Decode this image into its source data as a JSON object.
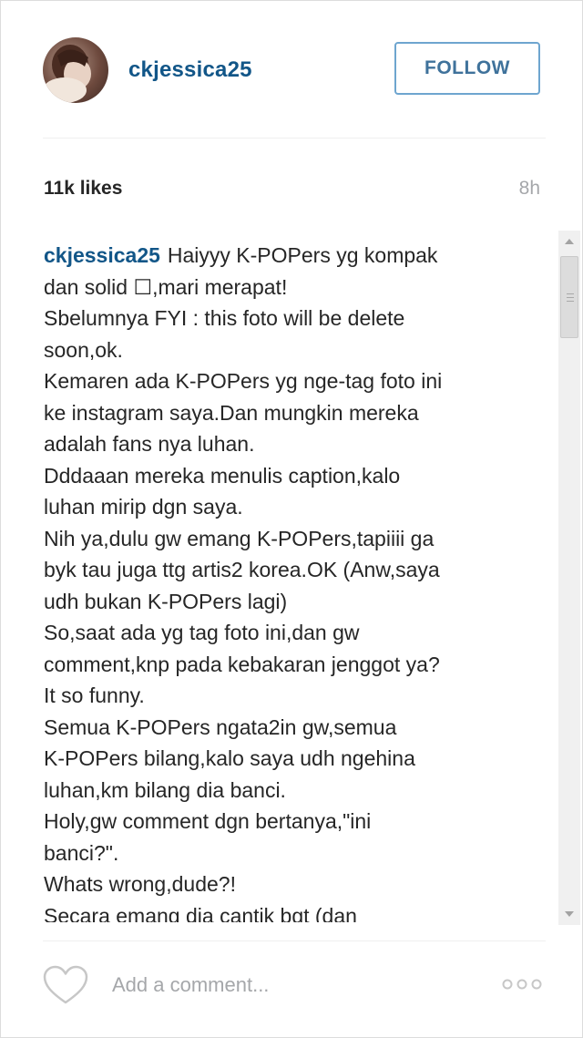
{
  "header": {
    "username": "ckjessica25",
    "follow_label": "FOLLOW"
  },
  "stats": {
    "likes": "11k likes",
    "time_ago": "8h"
  },
  "caption": {
    "username": "ckjessica25",
    "first_line": "Haiyyy K-POPers yg kompak",
    "lines": [
      "dan solid ☐,mari merapat!",
      "Sbelumnya FYI : this foto will be delete",
      "soon,ok.",
      "Kemaren ada K-POPers yg nge-tag foto ini",
      "ke instagram saya.Dan mungkin mereka",
      "adalah fans nya luhan.",
      "Dddaaan mereka menulis caption,kalo",
      "luhan mirip dgn saya.",
      "Nih ya,dulu gw emang K-POPers,tapiiii ga",
      "byk tau juga ttg artis2 korea.OK (Anw,saya",
      "udh bukan K-POPers lagi)",
      "So,saat ada yg tag foto ini,dan gw",
      "comment,knp pada kebakaran jenggot ya?",
      "It so funny.",
      "Semua K-POPers ngata2in gw,semua",
      "K-POPers bilang,kalo saya udh ngehina",
      "luhan,km bilang dia banci.",
      "Holy,gw comment dgn bertanya,\"ini",
      "banci?\".",
      "Whats wrong,dude?!",
      "Secara emang dia cantik bgt (dan"
    ]
  },
  "footer": {
    "comment_placeholder": "Add a comment...",
    "heart_icon": "heart-outline-icon",
    "more_icon": "more-options-icon"
  },
  "colors": {
    "username_blue": "#125688",
    "follow_border": "#6ea5cf",
    "follow_text": "#3f729b",
    "muted_text": "#a5a7aa",
    "body_text": "#262626"
  }
}
